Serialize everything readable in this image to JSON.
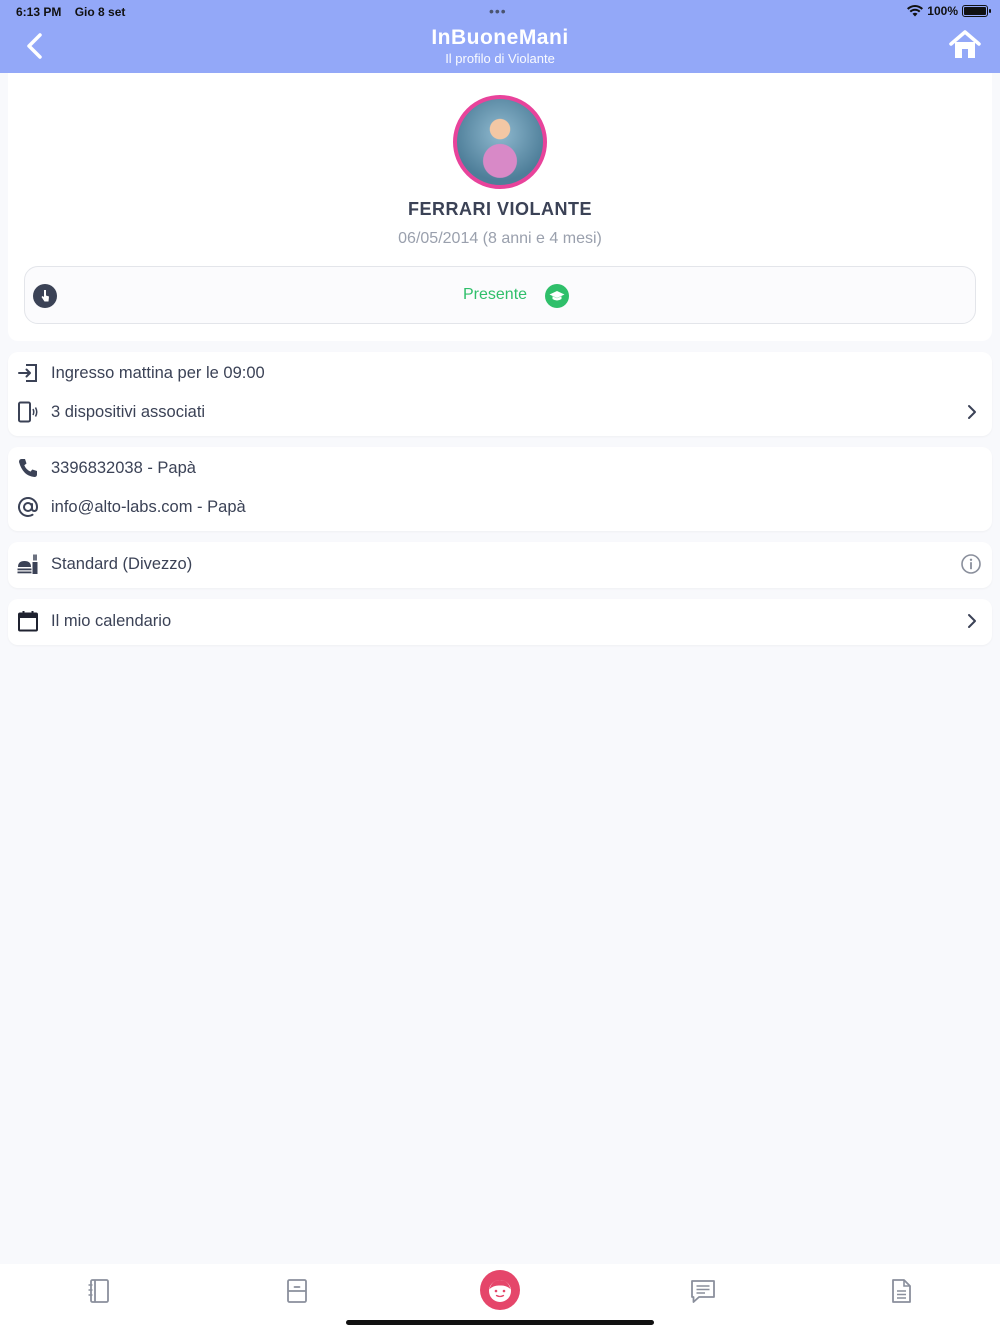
{
  "status": {
    "time": "6:13 PM",
    "date": "Gio 8 set",
    "battery": "100%"
  },
  "header": {
    "title": "InBuoneMani",
    "subtitle": "Il profilo di Violante",
    "back_icon": "chevron-left-icon",
    "home_icon": "home-icon",
    "color": "#93a8f8"
  },
  "profile": {
    "name": "FERRARI VIOLANTE",
    "birth": "06/05/2014 (8 anni e 4 mesi)",
    "avatar_border": "#e8439b",
    "presence_label": "Presente",
    "presence_color": "#2fbf6a"
  },
  "info_sections": [
    {
      "rows": [
        {
          "icon": "entrance-icon",
          "text": "Ingresso mattina per le 09:00"
        },
        {
          "icon": "device-icon",
          "text": "3 dispositivi associati"
        }
      ]
    },
    {
      "rows": [
        {
          "icon": "phone-icon",
          "text": "3396832038 - Papà"
        },
        {
          "icon": "at-icon",
          "text": "info@alto-labs.com - Papà"
        }
      ]
    },
    {
      "rows": [
        {
          "icon": "food-icon",
          "text": "Standard (Divezzo)"
        }
      ]
    },
    {
      "rows": [
        {
          "icon": "calendar-icon",
          "text": "Il mio calendario"
        }
      ]
    }
  ],
  "tabbar": {
    "tabs": [
      "diary-icon",
      "register-icon",
      "child-profile-icon",
      "messages-icon",
      "document-icon"
    ],
    "accent": "#e5466a"
  }
}
